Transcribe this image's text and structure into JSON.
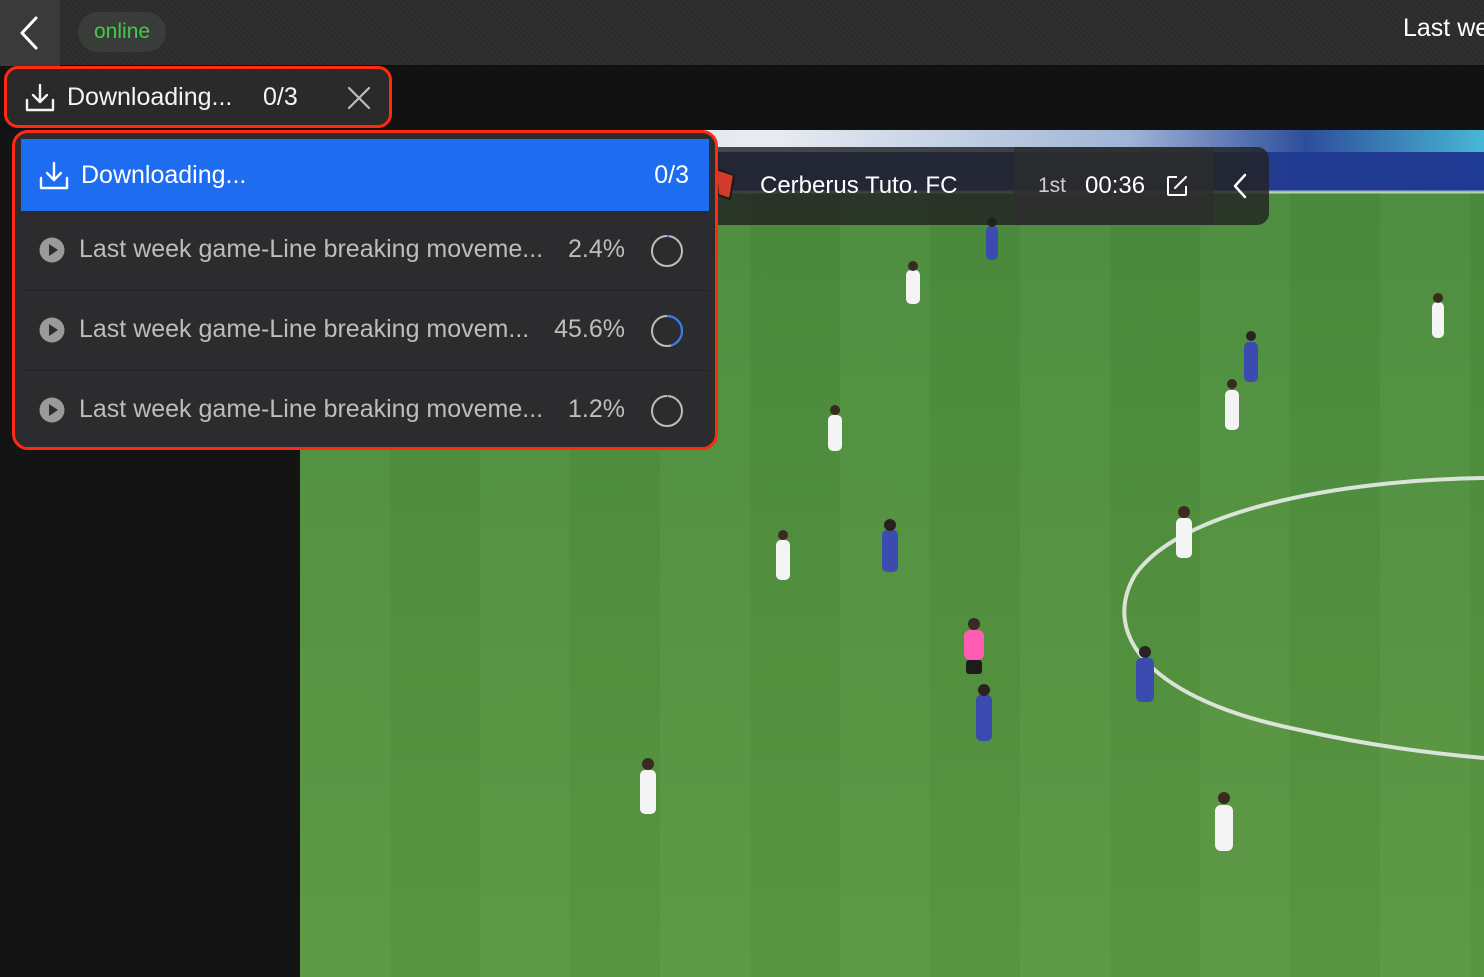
{
  "topbar": {
    "back_icon": "chevron-left-icon",
    "status": "online",
    "status_color": "#46c94a",
    "title": "Last we"
  },
  "download_chip": {
    "icon": "download-icon",
    "label": "Downloading...",
    "count": "0/3",
    "close_icon": "close-icon"
  },
  "scoreboard": {
    "team": "Cerberus Tuto. FC",
    "period": "1st",
    "clock": "00:36",
    "edit_icon": "edit-icon",
    "collapse_icon": "chevron-left-icon"
  },
  "dropdown": {
    "header": {
      "label": "Downloading...",
      "count": "0/3",
      "color": "#1e6df0"
    },
    "items": [
      {
        "name": "Last week game-Line breaking moveme...",
        "percent": "2.4%",
        "progress": 0.024
      },
      {
        "name": "Last week game-Line breaking movem...",
        "percent": "45.6%",
        "progress": 0.456
      },
      {
        "name": "Last week game-Line breaking moveme...",
        "percent": "1.2%",
        "progress": 0.012
      }
    ]
  },
  "highlight_color": "#ff2a10"
}
